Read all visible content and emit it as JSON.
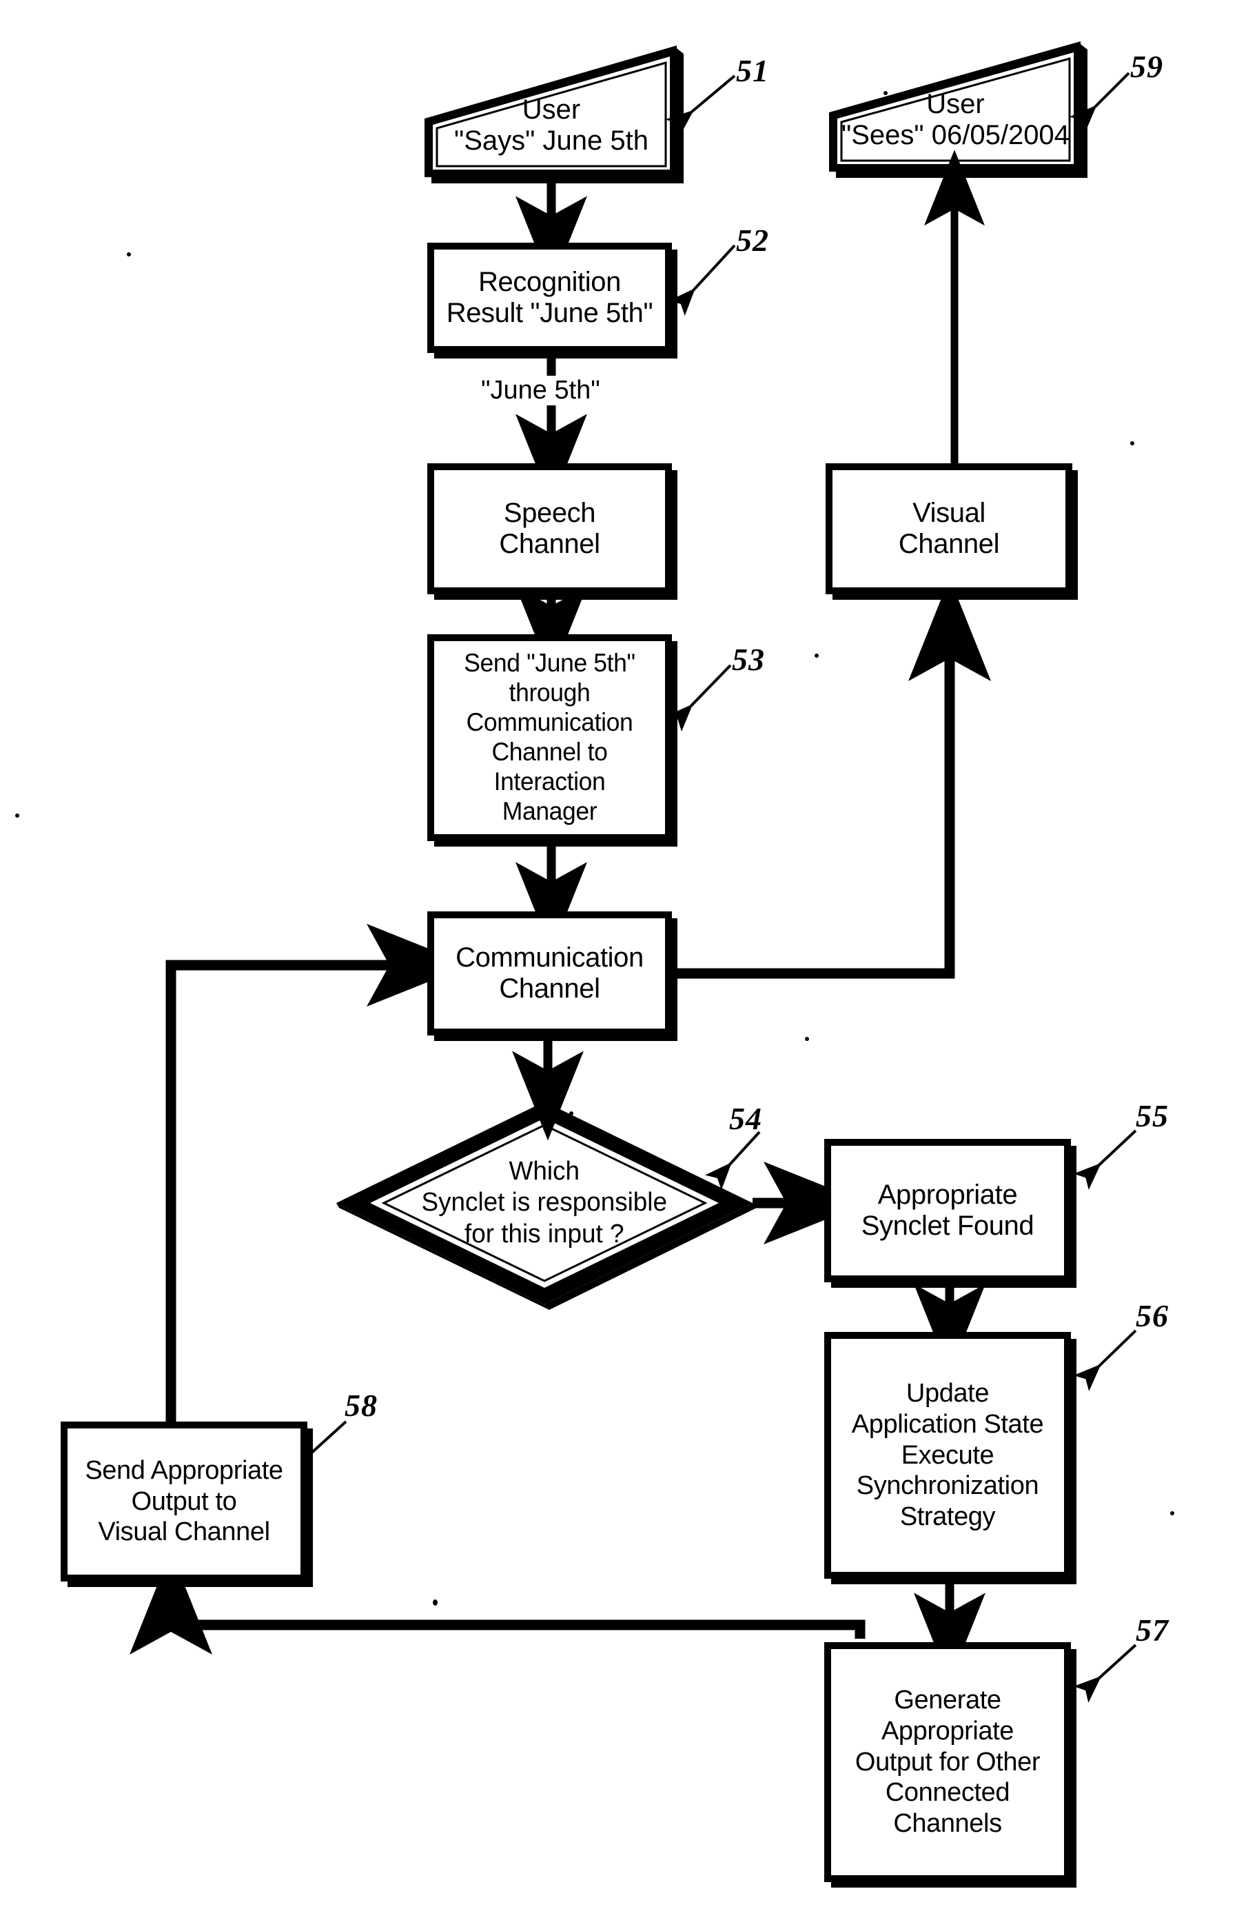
{
  "figure": {
    "title": "Multimodal interaction synchronization flowchart",
    "type": "flowchart"
  },
  "nodes": {
    "user_says": {
      "ref": "51",
      "text": "User\n\"Says\" June 5th",
      "shape": "trapezoid"
    },
    "recognition_result": {
      "ref": "52",
      "text": "Recognition\nResult \"June 5th\"",
      "shape": "rect"
    },
    "speech_channel": {
      "ref": "",
      "text": "Speech\nChannel",
      "shape": "rect"
    },
    "send_through_comm": {
      "ref": "53",
      "text": "Send \"June 5th\"\nthrough\nCommunication\nChannel to\nInteraction Manager",
      "shape": "rect"
    },
    "communication_channel": {
      "ref": "",
      "text": "Communication\nChannel",
      "shape": "rect"
    },
    "which_synclet": {
      "ref": "54",
      "text": "Which\nSynclet is responsible\nfor this input ?",
      "shape": "diamond"
    },
    "synclet_found": {
      "ref": "55",
      "text": "Appropriate\nSynclet Found",
      "shape": "rect"
    },
    "update_state": {
      "ref": "56",
      "text": "Update\nApplication State\nExecute\nSynchronization\nStrategy",
      "shape": "rect"
    },
    "generate_output": {
      "ref": "57",
      "text": "Generate\nAppropriate\nOutput for Other\nConnected\nChannels",
      "shape": "rect"
    },
    "send_to_visual": {
      "ref": "58",
      "text": "Send Appropriate\nOutput to\nVisual Channel",
      "shape": "rect"
    },
    "visual_channel": {
      "ref": "",
      "text": "Visual\nChannel",
      "shape": "rect"
    },
    "user_sees": {
      "ref": "59",
      "text": "User\n\"Sees\" 06/05/2004",
      "shape": "trapezoid"
    }
  },
  "edge_labels": {
    "june_5th": "\"June 5th\""
  },
  "reference_numerals": [
    "51",
    "52",
    "53",
    "54",
    "55",
    "56",
    "57",
    "58",
    "59"
  ],
  "colors": {
    "ink": "#000000",
    "paper": "#ffffff"
  }
}
